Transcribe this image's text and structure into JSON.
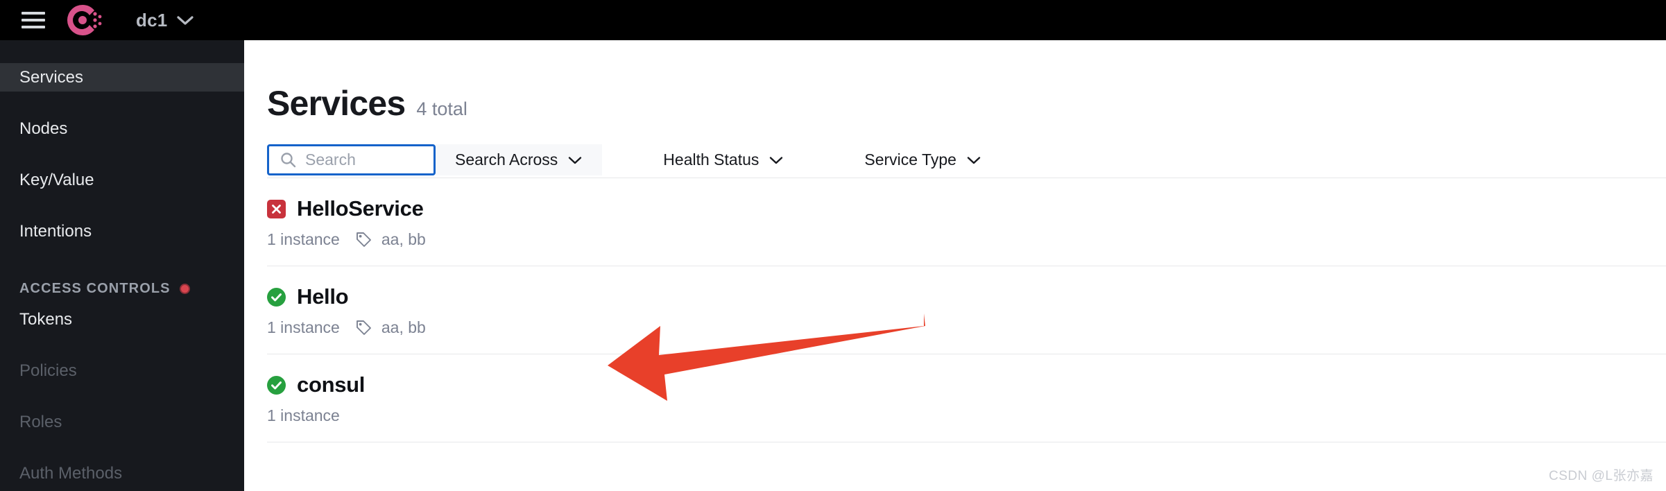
{
  "topbar": {
    "menu_icon": "hamburger-menu-icon",
    "logo": "consul-logo",
    "datacenter": "dc1",
    "datacenter_chevron": "chevron-down-icon"
  },
  "sidebar": {
    "items": [
      {
        "label": "Services",
        "active": true,
        "dim": false
      },
      {
        "label": "Nodes",
        "active": false,
        "dim": false
      },
      {
        "label": "Key/Value",
        "active": false,
        "dim": false
      },
      {
        "label": "Intentions",
        "active": false,
        "dim": false
      }
    ],
    "section": {
      "label": "ACCESS CONTROLS",
      "status_dot": "red-status-dot"
    },
    "acl_items": [
      {
        "label": "Tokens",
        "dim": false
      },
      {
        "label": "Policies",
        "dim": true
      },
      {
        "label": "Roles",
        "dim": true
      },
      {
        "label": "Auth Methods",
        "dim": true
      }
    ]
  },
  "main": {
    "title": "Services",
    "count_label": "4 total",
    "toolbar": {
      "search_icon": "search-icon",
      "search_placeholder": "Search",
      "search_value": "",
      "filters": [
        {
          "label": "Search Across",
          "chevron": "chevron-down-icon"
        },
        {
          "label": "Health Status",
          "chevron": "chevron-down-icon"
        },
        {
          "label": "Service Type",
          "chevron": "chevron-down-icon"
        }
      ]
    },
    "services": [
      {
        "name": "HelloService",
        "health": "critical",
        "health_icon": "x-circle-icon",
        "instances": "1 instance",
        "tag_icon": "tag-icon",
        "tags": "aa, bb"
      },
      {
        "name": "Hello",
        "health": "passing",
        "health_icon": "check-circle-icon",
        "instances": "1 instance",
        "tag_icon": "tag-icon",
        "tags": "aa, bb"
      },
      {
        "name": "consul",
        "health": "passing",
        "health_icon": "check-circle-icon",
        "instances": "1 instance",
        "tag_icon": "",
        "tags": ""
      }
    ]
  },
  "annotation": {
    "arrow": "red-pointer-arrow",
    "color": "#e8402a"
  },
  "watermark": "CSDN @L张亦嘉",
  "colors": {
    "topbar_bg": "#000000",
    "sidebar_bg": "#17191e",
    "sidebar_active_bg": "#2f3237",
    "brand_pink": "#d8528a",
    "focus_blue": "#1563ca",
    "health_ok": "#27a03f",
    "health_err": "#c8323c",
    "arrow_red": "#e8402a"
  }
}
